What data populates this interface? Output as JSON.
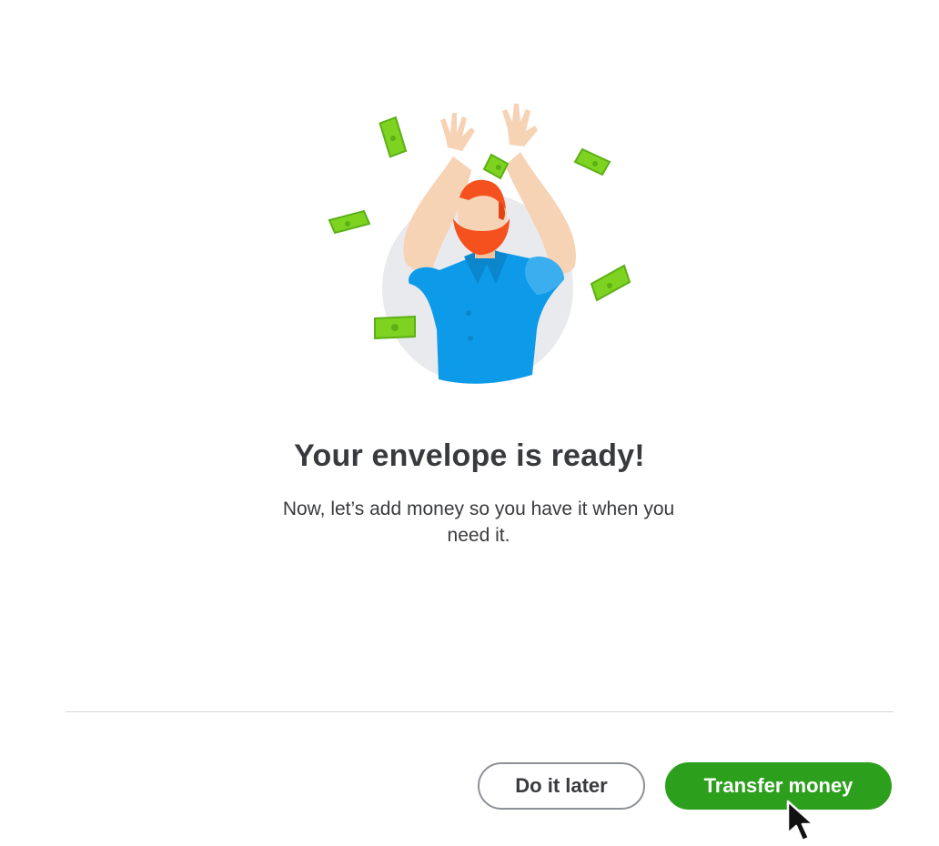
{
  "dialog": {
    "illustration": "man-throwing-money-icon",
    "title": "Your envelope is ready!",
    "subtitle": "Now, let’s add money so you have it when you need it."
  },
  "footer": {
    "secondary_button_label": "Do it later",
    "primary_button_label": "Transfer money"
  },
  "colors": {
    "primary": "#2ca01c",
    "text": "#393a3d",
    "divider": "#d4d7dc",
    "money": "#7ed321",
    "shirt": "#0d9ae8",
    "hair": "#f4511e"
  },
  "icons": {
    "cursor": "mouse-pointer-icon"
  }
}
